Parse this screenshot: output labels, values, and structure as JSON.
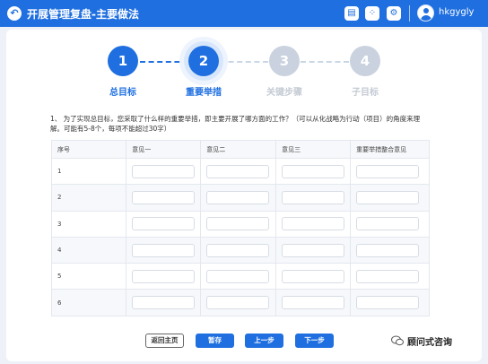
{
  "header": {
    "title": "开展管理复盘-主要做法",
    "icons": [
      "back-icon",
      "chat-icon",
      "apps-icon",
      "settings-icon"
    ],
    "username": "hkgygly"
  },
  "steps": [
    {
      "number": "1",
      "label": "总目标",
      "state": "done"
    },
    {
      "number": "2",
      "label": "重要举措",
      "state": "current"
    },
    {
      "number": "3",
      "label": "关键步骤",
      "state": "todo"
    },
    {
      "number": "4",
      "label": "子目标",
      "state": "todo"
    }
  ],
  "question": {
    "line1": "1、 为了实现总目标，您采取了什么样的重要举措，即主要开展了哪方面的工作？（可以从化战略为行动（项目）的角度来理",
    "line2": "解。可能有5-8个，每项不能超过30字）"
  },
  "table": {
    "headers": [
      "序号",
      "意见一",
      "意见二",
      "意见三",
      "重要举措整合意见"
    ],
    "rows": [
      "1",
      "2",
      "3",
      "4",
      "5",
      "6"
    ]
  },
  "buttons": {
    "home": "返回主页",
    "save": "暂存",
    "prev": "上一步",
    "next": "下一步"
  },
  "watermark": "顾问式咨询",
  "colors": {
    "primary": "#1f6fe0",
    "inactive": "#c9d2de"
  }
}
